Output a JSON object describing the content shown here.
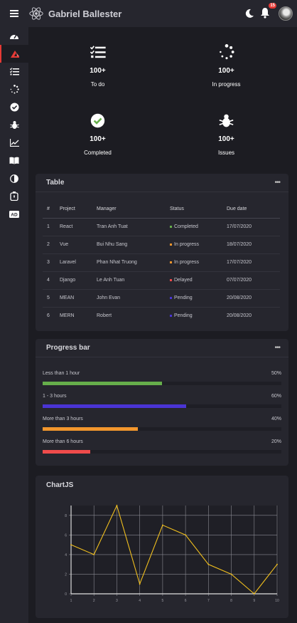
{
  "header": {
    "brand": "Gabriel Ballester",
    "notification_count": "15"
  },
  "sidebar": {
    "items": [
      {
        "icon": "speedometer-icon"
      },
      {
        "icon": "react-logo-icon",
        "active": true
      },
      {
        "icon": "task-list-icon"
      },
      {
        "icon": "spinner-icon"
      },
      {
        "icon": "check-circle-icon"
      },
      {
        "icon": "bug-icon"
      },
      {
        "icon": "chart-line-icon"
      },
      {
        "icon": "book-icon"
      },
      {
        "icon": "contrast-icon"
      },
      {
        "icon": "timer-icon"
      },
      {
        "icon": "ad-icon"
      }
    ]
  },
  "cards": [
    {
      "value": "100+",
      "label": "To do",
      "color": "#4a34d4",
      "icon": "task-list-icon"
    },
    {
      "value": "100+",
      "label": "In progress",
      "color": "#f2962d",
      "icon": "spinner-icon"
    },
    {
      "value": "100+",
      "label": "Completed",
      "color": "#66ae4b",
      "icon": "check-circle-icon"
    },
    {
      "value": "100+",
      "label": "Issues",
      "color": "#ef4b4b",
      "icon": "bug-icon"
    }
  ],
  "table": {
    "title": "Table",
    "columns": [
      "#",
      "Project",
      "Manager",
      "Status",
      "Due date"
    ],
    "rows": [
      {
        "num": "1",
        "project": "React",
        "manager": "Tran Anh Tuat",
        "status": "Completed",
        "status_color": "#66ae4b",
        "due": "17/07/2020"
      },
      {
        "num": "2",
        "project": "Vue",
        "manager": "Bui Nhu Sang",
        "status": "In progress",
        "status_color": "#f2962d",
        "due": "18/07/2020"
      },
      {
        "num": "3",
        "project": "Laravel",
        "manager": "Phan Nhat Truong",
        "status": "In progress",
        "status_color": "#f2962d",
        "due": "17/07/2020"
      },
      {
        "num": "4",
        "project": "Django",
        "manager": "Le Anh Tuan",
        "status": "Delayed",
        "status_color": "#ef4b4b",
        "due": "07/07/2020"
      },
      {
        "num": "5",
        "project": "MEAN",
        "manager": "John Evan",
        "status": "Pending",
        "status_color": "#4a34d4",
        "due": "20/08/2020"
      },
      {
        "num": "6",
        "project": "MERN",
        "manager": "Robert",
        "status": "Pending",
        "status_color": "#4a34d4",
        "due": "20/08/2020"
      }
    ]
  },
  "progress": {
    "title": "Progress bar",
    "items": [
      {
        "label": "Less than 1 hour",
        "value": "50%",
        "fraction": 0.5,
        "color": "#66ae4b"
      },
      {
        "label": "1 - 3 hours",
        "value": "60%",
        "fraction": 0.6,
        "color": "#4a34d4"
      },
      {
        "label": "More than 3 hours",
        "value": "40%",
        "fraction": 0.4,
        "color": "#f2962d"
      },
      {
        "label": "More than 6 hours",
        "value": "20%",
        "fraction": 0.2,
        "color": "#ef4b4b"
      }
    ]
  },
  "chart": {
    "title": "ChartJS"
  },
  "chart_data": {
    "type": "line",
    "x": [
      1,
      2,
      3,
      4,
      5,
      6,
      7,
      8,
      9,
      10
    ],
    "series": [
      {
        "values": [
          5,
          4,
          9,
          1,
          7,
          6,
          3,
          2,
          0,
          3
        ],
        "color": "#f2c01e"
      }
    ],
    "ylim": [
      0,
      9
    ],
    "yticks": [
      0,
      2,
      4,
      6,
      8
    ],
    "grid": true
  }
}
